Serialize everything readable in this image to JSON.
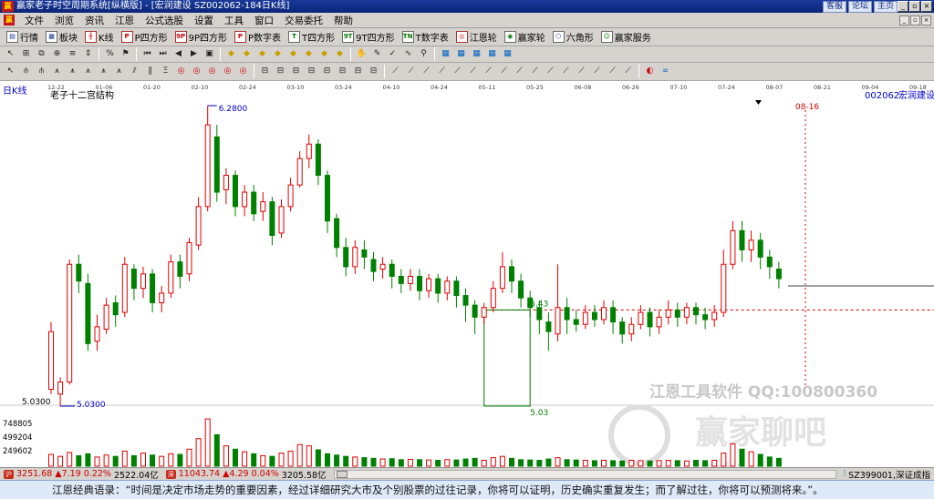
{
  "window": {
    "title": "赢家老子时空周期系统[纵横版] - [宏润建设  SZ002062-184日K线]",
    "links": [
      "客服",
      "论坛",
      "主页"
    ]
  },
  "menu": [
    "文件",
    "浏览",
    "资讯",
    "江恩",
    "公式选股",
    "设置",
    "工具",
    "窗口",
    "交易委托",
    "帮助"
  ],
  "toolbar1": [
    {
      "label": "行情",
      "icon": "quote-icon"
    },
    {
      "label": "板块",
      "icon": "sector-icon"
    },
    {
      "label": "K线",
      "icon": "kline-icon"
    },
    {
      "label": "P四方形",
      "icon": "p-square-icon"
    },
    {
      "label": "9P四方形",
      "icon": "9p-square-icon"
    },
    {
      "label": "P数字表",
      "icon": "p-number-table-icon"
    },
    {
      "label": "T四方形",
      "icon": "t-square-icon"
    },
    {
      "label": "9T四方形",
      "icon": "9t-square-icon"
    },
    {
      "label": "T数字表",
      "icon": "t-number-table-icon"
    },
    {
      "label": "江恩轮",
      "icon": "gann-wheel-icon"
    },
    {
      "label": "赢家轮",
      "icon": "winner-wheel-icon"
    },
    {
      "label": "六角形",
      "icon": "hexagon-icon"
    },
    {
      "label": "赢家服务",
      "icon": "service-icon"
    }
  ],
  "chart_header": {
    "period_label": "日K线",
    "study_label": "老子十二宫结构",
    "stock_code": "002062",
    "stock_name": "宏润建设"
  },
  "colors": {
    "up": "#e00000",
    "down": "#008000",
    "accent": "#0000c8",
    "grid": "#c8c8c8"
  },
  "chart_data": {
    "type": "candlestick",
    "x_tick_labels": [
      "12-22",
      "01-06",
      "01-20",
      "02-10",
      "02-24",
      "03-10",
      "03-24",
      "04-10",
      "04-24",
      "05-11",
      "05-25",
      "06-08",
      "06-26",
      "07-10",
      "07-24",
      "08-07",
      "08-21",
      "09-04",
      "09-18"
    ],
    "future_date_marker": "08-16",
    "annotations": {
      "high": "6.2800",
      "low": "5.0300",
      "level_1": "5.43",
      "level_2": "5.03",
      "axis_value": "5.0300"
    },
    "candles": [
      [
        5.1,
        5.34,
        5.08,
        5.38
      ],
      [
        5.08,
        5.13,
        5.03,
        5.15
      ],
      [
        5.13,
        5.62,
        5.12,
        5.64
      ],
      [
        5.62,
        5.55,
        5.5,
        5.66
      ],
      [
        5.54,
        5.29,
        5.26,
        5.58
      ],
      [
        5.3,
        5.36,
        5.26,
        5.41
      ],
      [
        5.35,
        5.45,
        5.33,
        5.48
      ],
      [
        5.46,
        5.41,
        5.36,
        5.49
      ],
      [
        5.42,
        5.62,
        5.4,
        5.65
      ],
      [
        5.6,
        5.52,
        5.47,
        5.62
      ],
      [
        5.52,
        5.58,
        5.48,
        5.61
      ],
      [
        5.58,
        5.46,
        5.42,
        5.6
      ],
      [
        5.46,
        5.5,
        5.42,
        5.53
      ],
      [
        5.5,
        5.63,
        5.48,
        5.66
      ],
      [
        5.63,
        5.57,
        5.52,
        5.66
      ],
      [
        5.58,
        5.71,
        5.55,
        5.73
      ],
      [
        5.7,
        5.86,
        5.68,
        5.9
      ],
      [
        5.86,
        6.2,
        5.84,
        6.28
      ],
      [
        6.15,
        5.92,
        5.88,
        6.2
      ],
      [
        5.93,
        5.99,
        5.87,
        6.02
      ],
      [
        5.99,
        5.86,
        5.82,
        6.01
      ],
      [
        5.86,
        5.92,
        5.82,
        5.95
      ],
      [
        5.92,
        5.83,
        5.8,
        5.95
      ],
      [
        5.84,
        5.88,
        5.8,
        5.92
      ],
      [
        5.88,
        5.74,
        5.7,
        5.9
      ],
      [
        5.75,
        5.86,
        5.73,
        5.89
      ],
      [
        5.86,
        5.95,
        5.84,
        5.98
      ],
      [
        5.95,
        6.06,
        5.94,
        6.09
      ],
      [
        6.06,
        6.12,
        6.02,
        6.16
      ],
      [
        6.12,
        5.99,
        5.95,
        6.14
      ],
      [
        5.99,
        5.8,
        5.75,
        6.01
      ],
      [
        5.81,
        5.69,
        5.65,
        5.83
      ],
      [
        5.69,
        5.61,
        5.57,
        5.73
      ],
      [
        5.61,
        5.69,
        5.58,
        5.72
      ],
      [
        5.68,
        5.65,
        5.6,
        5.72
      ],
      [
        5.64,
        5.59,
        5.55,
        5.67
      ],
      [
        5.6,
        5.62,
        5.56,
        5.65
      ],
      [
        5.62,
        5.57,
        5.52,
        5.64
      ],
      [
        5.57,
        5.54,
        5.5,
        5.6
      ],
      [
        5.54,
        5.57,
        5.51,
        5.6
      ],
      [
        5.57,
        5.51,
        5.47,
        5.6
      ],
      [
        5.51,
        5.56,
        5.48,
        5.58
      ],
      [
        5.56,
        5.5,
        5.46,
        5.58
      ],
      [
        5.5,
        5.55,
        5.47,
        5.57
      ],
      [
        5.55,
        5.49,
        5.44,
        5.57
      ],
      [
        5.49,
        5.45,
        5.38,
        5.52
      ],
      [
        5.45,
        5.4,
        5.33,
        5.47
      ],
      [
        5.4,
        5.44,
        5.37,
        5.46
      ],
      [
        5.44,
        5.52,
        5.42,
        5.55
      ],
      [
        5.52,
        5.61,
        5.5,
        5.67
      ],
      [
        5.61,
        5.55,
        5.5,
        5.64
      ],
      [
        5.55,
        5.48,
        5.44,
        5.58
      ],
      [
        5.48,
        5.44,
        5.4,
        5.51
      ],
      [
        5.44,
        5.39,
        5.33,
        5.47
      ],
      [
        5.38,
        5.34,
        5.26,
        5.42
      ],
      [
        5.33,
        5.44,
        5.3,
        5.62
      ],
      [
        5.44,
        5.39,
        5.33,
        5.48
      ],
      [
        5.39,
        5.37,
        5.34,
        5.43
      ],
      [
        5.37,
        5.42,
        5.35,
        5.45
      ],
      [
        5.42,
        5.39,
        5.36,
        5.45
      ],
      [
        5.39,
        5.44,
        5.37,
        5.47
      ],
      [
        5.44,
        5.38,
        5.33,
        5.47
      ],
      [
        5.38,
        5.33,
        5.29,
        5.4
      ],
      [
        5.33,
        5.37,
        5.3,
        5.4
      ],
      [
        5.37,
        5.42,
        5.35,
        5.45
      ],
      [
        5.42,
        5.36,
        5.32,
        5.44
      ],
      [
        5.36,
        5.4,
        5.33,
        5.43
      ],
      [
        5.4,
        5.43,
        5.37,
        5.47
      ],
      [
        5.43,
        5.4,
        5.36,
        5.46
      ],
      [
        5.4,
        5.44,
        5.37,
        5.46
      ],
      [
        5.44,
        5.41,
        5.37,
        5.46
      ],
      [
        5.41,
        5.39,
        5.35,
        5.44
      ],
      [
        5.39,
        5.42,
        5.36,
        5.45
      ],
      [
        5.42,
        5.62,
        5.4,
        5.68
      ],
      [
        5.62,
        5.76,
        5.6,
        5.8
      ],
      [
        5.76,
        5.68,
        5.63,
        5.8
      ],
      [
        5.68,
        5.72,
        5.63,
        5.76
      ],
      [
        5.72,
        5.65,
        5.6,
        5.75
      ],
      [
        5.65,
        5.61,
        5.56,
        5.68
      ],
      [
        5.6,
        5.56,
        5.52,
        5.63
      ]
    ],
    "volume_axis_labels": [
      "748805",
      "499204",
      "249602"
    ],
    "volumes": [
      180000,
      150000,
      210000,
      160000,
      190000,
      140000,
      170000,
      150000,
      230000,
      160000,
      200000,
      170000,
      150000,
      190000,
      180000,
      260000,
      420000,
      720000,
      480000,
      310000,
      260000,
      220000,
      190000,
      160000,
      150000,
      200000,
      230000,
      330000,
      310000,
      250000,
      190000,
      170000,
      150000,
      140000,
      130000,
      120000,
      110000,
      115000,
      100000,
      105000,
      100000,
      95000,
      90000,
      100000,
      95000,
      110000,
      120000,
      90000,
      130000,
      150000,
      120000,
      100000,
      95000,
      90000,
      110000,
      130000,
      100000,
      95000,
      90000,
      85000,
      90000,
      85000,
      80000,
      90000,
      85000,
      80000,
      85000,
      90000,
      85000,
      80000,
      90000,
      85000,
      90000,
      200000,
      340000,
      260000,
      220000,
      180000,
      140000,
      120000
    ]
  },
  "status_bar": {
    "index1_value": "3251.68",
    "index1_change": "▲7.19 0.22%",
    "index1_amount": "2522.04亿",
    "index2_value": "11043.74",
    "index2_change": "▲4.29 0.04%",
    "index2_amount": "3205.58亿",
    "right_label": "SZ399001,深证成指"
  },
  "watermarks": {
    "line1": "江恩工具软件 QQ:100800360",
    "line2": "赢家聊吧",
    "line3": "jiaoba.yu..."
  },
  "quote": "江恩经典语录：“时间是决定市场走势的重要因素，经过详细研究大市及个别股票的过往记录，你将可以证明，历史确实重复发生；而了解过往，你将可以预测将来。”。"
}
